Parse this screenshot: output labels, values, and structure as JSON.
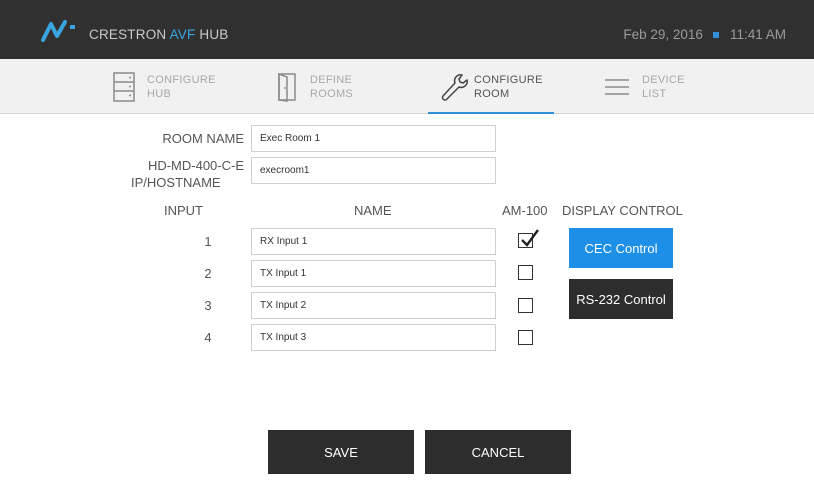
{
  "header": {
    "brand_prefix": "CRESTRON ",
    "brand_accent": "AVF",
    "brand_suffix": " HUB",
    "date": "Feb 29, 2016",
    "time": "11:41 AM"
  },
  "nav": {
    "tabs": [
      {
        "label": "CONFIGURE\nHUB",
        "icon": "server-icon",
        "active": false
      },
      {
        "label": "DEFINE\nROOMS",
        "icon": "door-icon",
        "active": false
      },
      {
        "label": "CONFIGURE\nROOM",
        "icon": "wrench-icon",
        "active": true
      },
      {
        "label": "DEVICE\nLIST",
        "icon": "list-icon",
        "active": false
      }
    ]
  },
  "form": {
    "room_name_label": "ROOM NAME",
    "room_name_value": "Exec Room 1",
    "host_label_line1": "HD-MD-400-C-E",
    "host_label_line2": "IP/HOSTNAME",
    "host_value": "execroom1",
    "columns": {
      "input": "INPUT",
      "name": "NAME",
      "am100": "AM-100",
      "display": "DISPLAY CONTROL"
    },
    "inputs": [
      {
        "number": "1",
        "name": "RX Input 1",
        "am100": true
      },
      {
        "number": "2",
        "name": "TX Input 1",
        "am100": false
      },
      {
        "number": "3",
        "name": "TX Input 2",
        "am100": false
      },
      {
        "number": "4",
        "name": "TX Input 3",
        "am100": false
      }
    ],
    "cec_button": "CEC Control",
    "rs232_button": "RS-232 Control"
  },
  "actions": {
    "save": "SAVE",
    "cancel": "CANCEL"
  },
  "colors": {
    "accent": "#2f8fd8",
    "cec_button": "#1e8fe6",
    "dark": "#2d2d2d",
    "topbar": "#303030"
  }
}
